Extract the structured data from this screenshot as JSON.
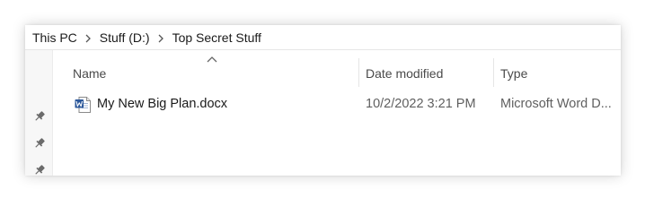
{
  "breadcrumb": {
    "items": [
      {
        "label": "This PC"
      },
      {
        "label": "Stuff (D:)"
      },
      {
        "label": "Top Secret Stuff"
      }
    ]
  },
  "nav": {
    "pins": [
      "pin-icon",
      "pin-icon",
      "pin-icon"
    ]
  },
  "columns": {
    "name": "Name",
    "date_modified": "Date modified",
    "type": "Type",
    "sort_icon": "sort-ascending-icon"
  },
  "files": [
    {
      "icon": "word-document-icon",
      "name": "My New Big Plan.docx",
      "date_modified": "10/2/2022 3:21 PM",
      "type": "Microsoft Word D..."
    }
  ],
  "colors": {
    "text_primary": "#1a1a1a",
    "text_secondary": "#5f5f5f",
    "word_blue": "#2b579a"
  }
}
